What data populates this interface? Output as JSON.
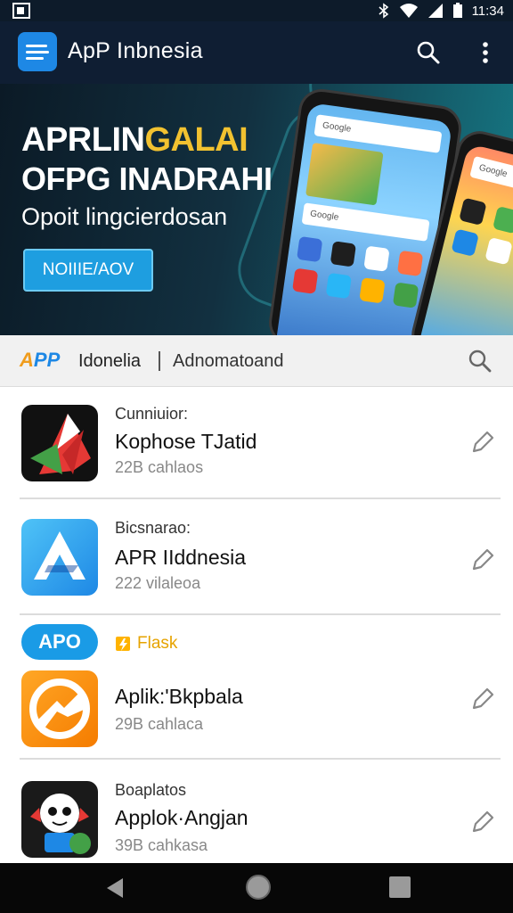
{
  "status_bar": {
    "time": "11:34",
    "colors": {
      "background": "#0d1b2a",
      "text": "#ffffff"
    }
  },
  "app_bar": {
    "title": "ApP Inbnesia",
    "icons": [
      "app-logo-icon",
      "search-icon",
      "more-vert-icon"
    ],
    "colors": {
      "background": "#0f1e33",
      "logo": "#1e88e5"
    }
  },
  "banner": {
    "line1_white": "APRLIN",
    "line1_yellow": "GALAI",
    "line2": "OFPG INADRAHI",
    "line3": "Opoit lingcierdosan",
    "button_label": "NOIIIE/AOV",
    "phone_left_search": "Google",
    "phone_left_subsearch": "Google",
    "phone_right_search": "Google",
    "colors": {
      "accent": "#f2c230",
      "button": "#1e9ee0"
    }
  },
  "search_row": {
    "brand_prefix": "A",
    "brand_suffix": "PP",
    "query_1": "Idonelia",
    "query_2": "Adnomatoand",
    "icons": [
      "search-icon"
    ]
  },
  "list": {
    "items": [
      {
        "category": "Cunniuior:",
        "name": "Kophose TJatid",
        "meta": "22B cahlaos"
      },
      {
        "category": "Bicsnarao:",
        "name": "APR IIddnesia",
        "meta": "222 vilaleoa"
      },
      {
        "category": "",
        "name": "Aplik:'Bkpbala",
        "meta": "29B cahlaca"
      },
      {
        "category": "Boaplatos",
        "name": "Applok·Angjan",
        "meta": "39B cahkasa"
      }
    ],
    "chip_label": "APO",
    "flash_label": "Flask",
    "icons": [
      "edit-pen-icon",
      "flash-icon"
    ]
  },
  "nav_bar": {
    "icons": [
      "back-icon",
      "home-icon",
      "recent-apps-icon"
    ]
  }
}
